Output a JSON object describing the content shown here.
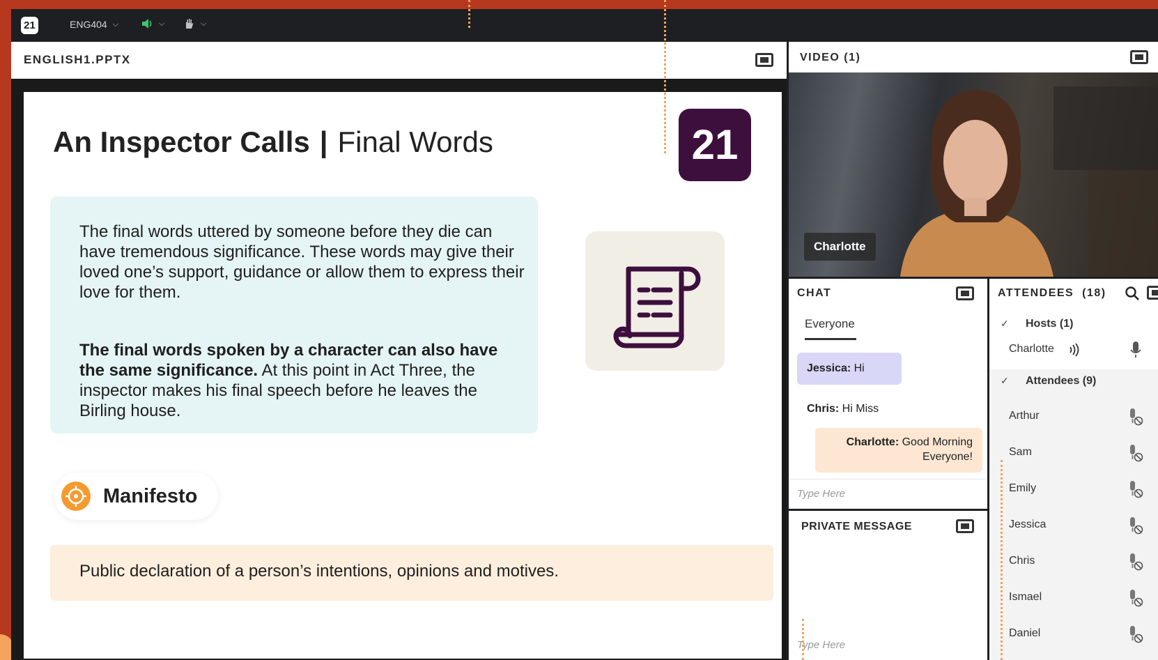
{
  "toolbar": {
    "logo": "21",
    "course": "ENG404",
    "audio_icon": "speaker-icon",
    "hand_icon": "raise-hand-icon"
  },
  "presentation": {
    "file_name": "ENGLISH1.PPTX",
    "slide": {
      "title_bold": "An Inspector Calls",
      "title_separator": "|",
      "title_sub": "Final Words",
      "brand_number": "21",
      "paragraph1": "The final words uttered by someone before they die can have tremendous significance. These words may give their loved one’s support, guidance or allow them to express their love for them.",
      "paragraph2_bold": "The final words spoken by a character can also have the same significance.",
      "paragraph2_rest": " At this point in Act Three, the inspector makes his final speech before he leaves the Birling house.",
      "keyword": "Manifesto",
      "definition": "Public declaration of a person’s intentions, opinions and motives."
    }
  },
  "video": {
    "title": "VIDEO (1)",
    "participant_name": "Charlotte"
  },
  "chat": {
    "title": "CHAT",
    "tab": "Everyone",
    "messages": [
      {
        "sender": "Jessica:",
        "text": " Hi"
      },
      {
        "sender": "Chris:",
        "text": " Hi Miss"
      },
      {
        "sender": "Charlotte:",
        "text": " Good Morning Everyone!"
      }
    ],
    "placeholder": "Type Here"
  },
  "private_message": {
    "title": "PRIVATE MESSAGE",
    "placeholder": "Type Here"
  },
  "attendees": {
    "title": "ATTENDEES",
    "count": "(18)",
    "hosts_label": "Hosts (1)",
    "hosts": [
      "Charlotte"
    ],
    "attendees_label": "Attendees (9)",
    "list": [
      "Arthur",
      "Sam",
      "Emily",
      "Jessica",
      "Chris",
      "Ismael",
      "Daniel"
    ]
  },
  "colors": {
    "frame": "#b5381f",
    "brand_purple": "#3d0f3d",
    "accent_orange": "#f59a2e",
    "text_box": "#e5f4f5",
    "definition_box": "#fdeedd"
  }
}
